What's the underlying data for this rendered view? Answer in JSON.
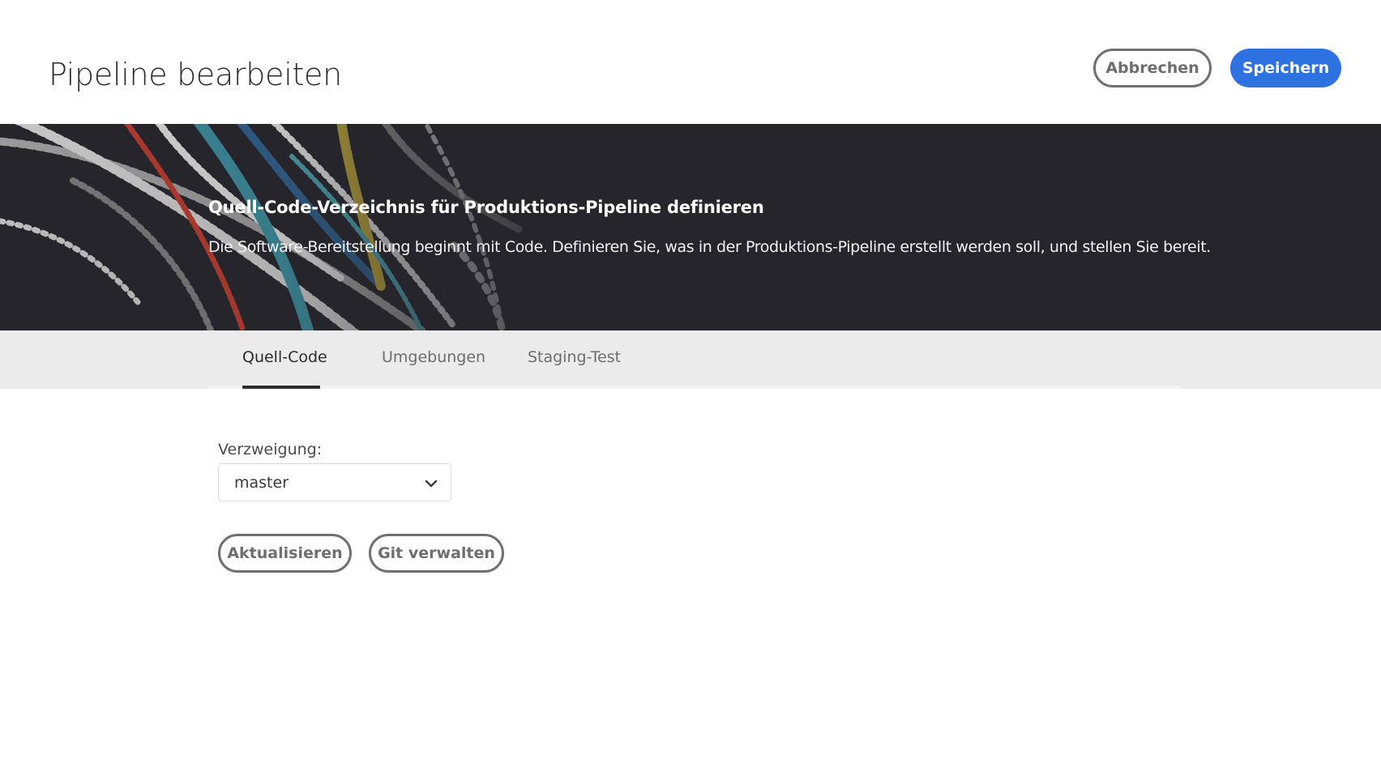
{
  "header": {
    "title": "Pipeline bearbeiten",
    "cancel_label": "Abbrechen",
    "save_label": "Speichern"
  },
  "hero": {
    "heading": "Quell-Code-Verzeichnis für Produktions-Pipeline definieren",
    "description": "Die Software-Bereitstellung beginnt mit Code. Definieren Sie, was in der Produktions-Pipeline erstellt werden soll, und stellen Sie bereit."
  },
  "tabs": [
    {
      "label": "Quell-Code",
      "active": true
    },
    {
      "label": "Umgebungen",
      "active": false
    },
    {
      "label": "Staging-Test",
      "active": false
    }
  ],
  "form": {
    "branch_label": "Verzweigung:",
    "branch_value": "master",
    "update_label": "Aktualisieren",
    "git_label": "Git verwalten"
  },
  "colors": {
    "primary": "#2e71e0",
    "hero_background": "#26252b",
    "tabbar_background": "#ebebeb"
  },
  "icons": {
    "select_arrow": "chevron-down-icon"
  }
}
